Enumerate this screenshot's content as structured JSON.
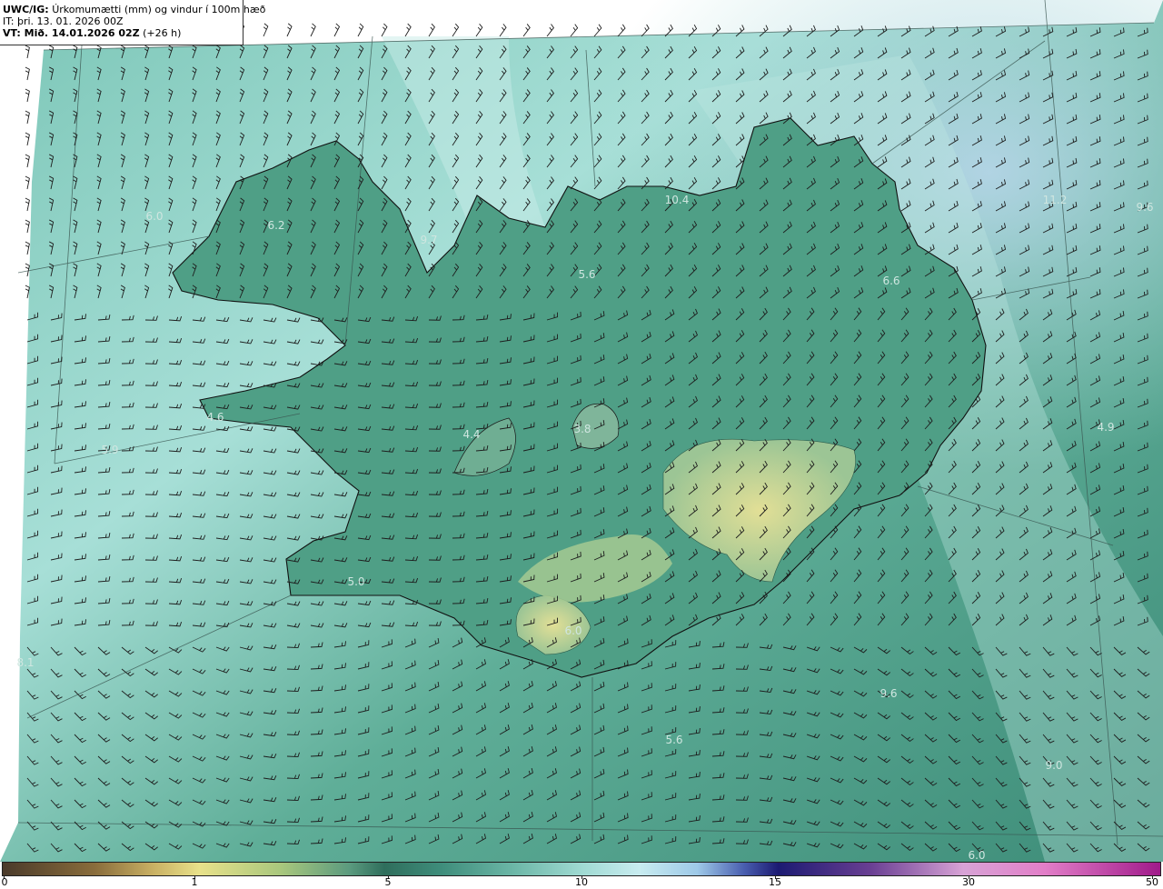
{
  "header": {
    "model": "UWC/IG:",
    "title": "Úrkomumætti (mm) og vindur í 100m hæð",
    "issue_time": "IT: þri. 13. 01. 2026 00Z",
    "valid_prefix": "VT: Mið. 14.01.2026 02Z",
    "valid_offset": "(+26 h)"
  },
  "map_labels": [
    "6.2",
    "9.7",
    "5.6",
    "6.6",
    "11.2",
    "10.4",
    "6.0",
    "9.6",
    "4.6",
    "5.9",
    "4.4",
    "3.8",
    "4.9",
    "5.0",
    "6.0",
    "8.1",
    "9.6",
    "5.6",
    "9.0",
    "6.0"
  ],
  "colorbar": {
    "ticks": [
      "0",
      "1",
      "5",
      "10",
      "15",
      "30",
      "50"
    ]
  },
  "colors": {
    "sea_base": "#4a9a86",
    "sea_light": "#9fd9d2",
    "land_dark": "#3f8e77",
    "glacier_yellow": "#c9d48a",
    "coast": "#1a1a1a"
  }
}
